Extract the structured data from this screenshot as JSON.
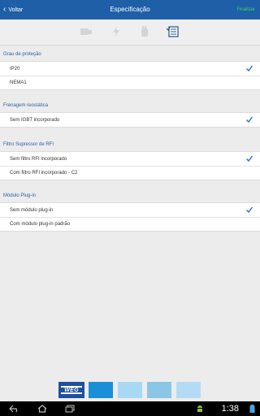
{
  "header": {
    "back_label": "Voltar",
    "title": "Especificação",
    "finish_label": "Finalizar"
  },
  "steps": [
    {
      "icon": "drive-icon",
      "state": "inactive"
    },
    {
      "icon": "lightning-icon",
      "state": "inactive"
    },
    {
      "icon": "hand-icon",
      "state": "inactive"
    },
    {
      "icon": "spec-list-icon",
      "state": "active"
    }
  ],
  "sections": [
    {
      "title": "Grau de proteção",
      "options": [
        {
          "label": "IP20",
          "selected": true
        },
        {
          "label": "NEMA1",
          "selected": false
        }
      ]
    },
    {
      "title": "Frenagem reostática",
      "options": [
        {
          "label": "Sem IGBT incorporado",
          "selected": true
        }
      ]
    },
    {
      "title": "Filtro Supressor de RFI",
      "options": [
        {
          "label": "Sem filtro RFI incorporado",
          "selected": true
        },
        {
          "label": "Com filtro RFI incorporado - C2",
          "selected": false
        }
      ]
    },
    {
      "title": "Módulo Plug-in",
      "options": [
        {
          "label": "Sem módulo plug-in",
          "selected": true
        },
        {
          "label": "Com módulo plug-in padrão",
          "selected": false
        }
      ]
    }
  ],
  "bottom": {
    "logo_text": "WEG",
    "tiles": [
      "#1a8fd6",
      "#a9d8f2",
      "#8cc6e6",
      "#b3dcf4"
    ]
  },
  "system": {
    "time": "1:38"
  },
  "colors": {
    "header_bg": "#1f5fa8",
    "accent": "#2a72c8",
    "finish": "#38d26a"
  }
}
